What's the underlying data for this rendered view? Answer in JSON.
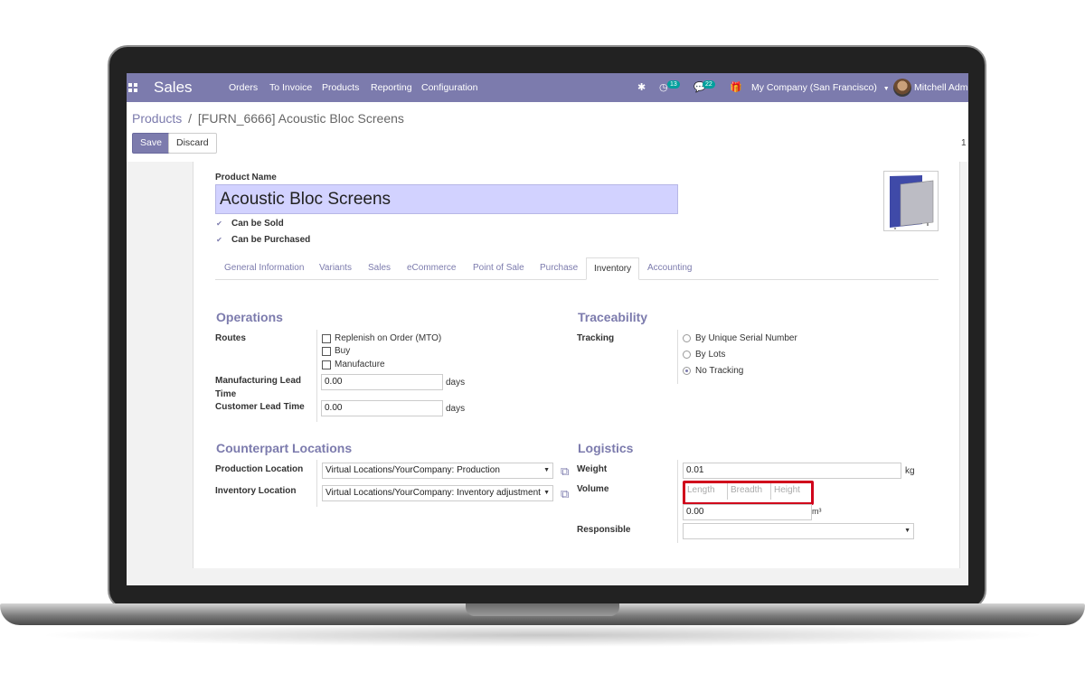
{
  "navbar": {
    "app_title": "Sales",
    "menu": [
      "Orders",
      "To Invoice",
      "Products",
      "Reporting",
      "Configuration"
    ],
    "activity_count": "13",
    "message_count": "22",
    "company": "My Company (San Francisco)",
    "user": "Mitchell Admin"
  },
  "breadcrumb": {
    "parent": "Products",
    "separator": "/",
    "current": "[FURN_6666] Acoustic Bloc Screens"
  },
  "buttons": {
    "save": "Save",
    "discard": "Discard"
  },
  "pager": "1",
  "product": {
    "name_label": "Product Name",
    "name": "Acoustic Bloc Screens",
    "can_be_sold": "Can be Sold",
    "can_be_purchased": "Can be Purchased"
  },
  "tabs": [
    "General Information",
    "Variants",
    "Sales",
    "eCommerce",
    "Point of Sale",
    "Purchase",
    "Inventory",
    "Accounting"
  ],
  "active_tab": "Inventory",
  "operations": {
    "title": "Operations",
    "routes_label": "Routes",
    "routes": [
      "Replenish on Order (MTO)",
      "Buy",
      "Manufacture"
    ],
    "mfg_lead_label_1": "Manufacturing Lead",
    "mfg_lead_label_2": "Time",
    "mfg_lead_value": "0.00",
    "customer_lead_label": "Customer Lead Time",
    "customer_lead_value": "0.00",
    "unit": "days"
  },
  "traceability": {
    "title": "Traceability",
    "tracking_label": "Tracking",
    "options": [
      "By Unique Serial Number",
      "By Lots",
      "No Tracking"
    ],
    "selected": "No Tracking"
  },
  "counterpart": {
    "title": "Counterpart Locations",
    "production_label": "Production Location",
    "production_value": "Virtual Locations/YourCompany: Production",
    "inventory_label": "Inventory Location",
    "inventory_value": "Virtual Locations/YourCompany: Inventory adjustment"
  },
  "logistics": {
    "title": "Logistics",
    "weight_label": "Weight",
    "weight_value": "0.01",
    "weight_unit": "kg",
    "volume_label": "Volume",
    "length_placeholder": "Length",
    "breadth_placeholder": "Breadth",
    "height_placeholder": "Height",
    "volume_value": "0.00",
    "volume_unit": "m³",
    "responsible_label": "Responsible",
    "responsible_value": ""
  },
  "colors": {
    "brand": "#7c7bad",
    "highlight": "#d0021b",
    "name_input_bg": "#d2d2ff"
  }
}
